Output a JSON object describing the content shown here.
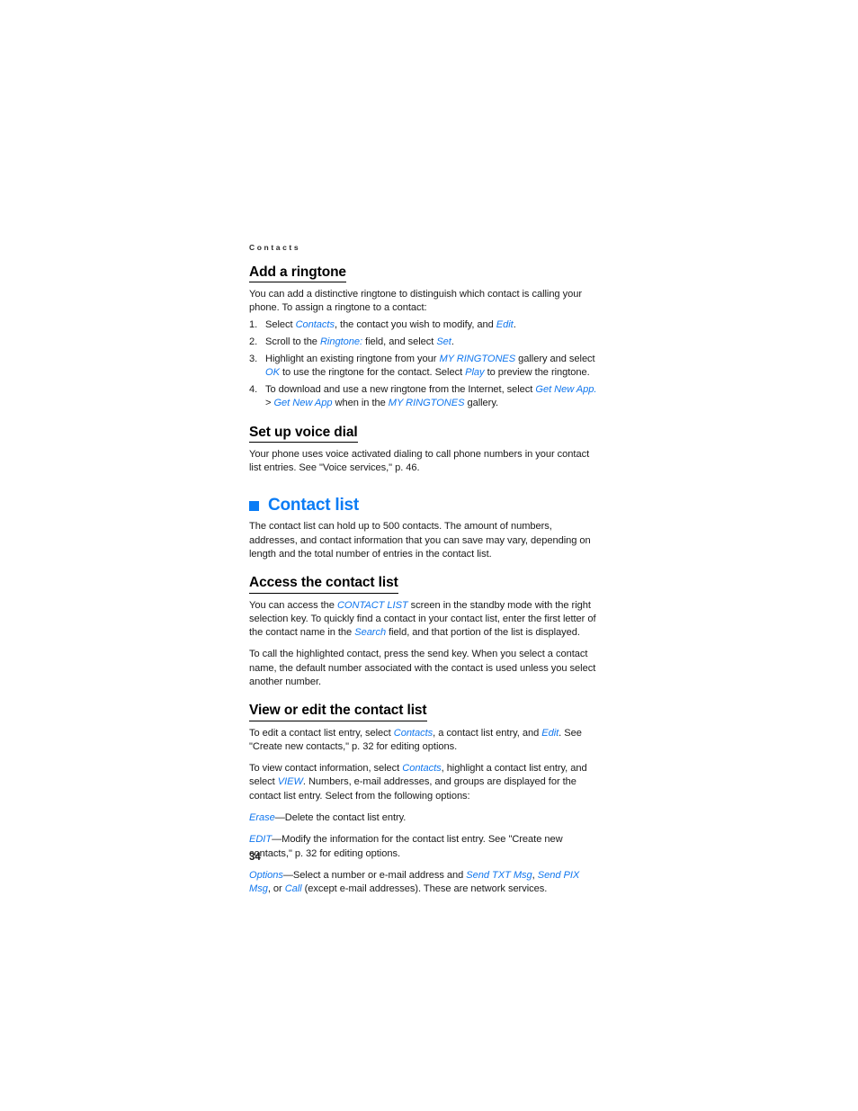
{
  "document": {
    "running_head": "Contacts",
    "page_number": "34"
  },
  "sections": {
    "add_ringtone": {
      "heading": "Add a ringtone",
      "intro": "You can add a distinctive ringtone to distinguish which contact is calling your phone. To assign a ringtone to a contact:",
      "steps": [
        {
          "number": "1.",
          "parts": [
            {
              "text": "Select ",
              "style": "plain"
            },
            {
              "text": "Contacts",
              "style": "ui"
            },
            {
              "text": ", the contact you wish to modify, and ",
              "style": "plain"
            },
            {
              "text": "Edit",
              "style": "ui"
            },
            {
              "text": ".",
              "style": "plain"
            }
          ]
        },
        {
          "number": "2.",
          "parts": [
            {
              "text": "Scroll to the ",
              "style": "plain"
            },
            {
              "text": "Ringtone:",
              "style": "ui"
            },
            {
              "text": " field, and select ",
              "style": "plain"
            },
            {
              "text": "Set",
              "style": "ui"
            },
            {
              "text": ".",
              "style": "plain"
            }
          ]
        },
        {
          "number": "3.",
          "parts": [
            {
              "text": "Highlight an existing ringtone from your ",
              "style": "plain"
            },
            {
              "text": "MY RINGTONES",
              "style": "ui"
            },
            {
              "text": " gallery and select ",
              "style": "plain"
            },
            {
              "text": "OK",
              "style": "ui"
            },
            {
              "text": " to use the ringtone for the contact. Select ",
              "style": "plain"
            },
            {
              "text": "Play",
              "style": "ui"
            },
            {
              "text": " to preview the ringtone.",
              "style": "plain"
            }
          ]
        },
        {
          "number": "4.",
          "parts": [
            {
              "text": "To download and use a new ringtone from the Internet, select ",
              "style": "plain"
            },
            {
              "text": "Get New App.",
              "style": "ui"
            },
            {
              "text": " > ",
              "style": "plain"
            },
            {
              "text": "Get New App",
              "style": "ui"
            },
            {
              "text": " when in the ",
              "style": "plain"
            },
            {
              "text": "MY RINGTONES",
              "style": "ui"
            },
            {
              "text": " gallery.",
              "style": "plain"
            }
          ]
        }
      ]
    },
    "voice_dial": {
      "heading": "Set up voice dial",
      "body": "Your phone uses voice activated dialing to call phone numbers in your contact list entries. See \"Voice services,\" p. 46."
    },
    "contact_list": {
      "heading": "Contact list",
      "bullet_color": "#0a7cf5",
      "body": "The contact list can hold up to 500 contacts. The amount of numbers, addresses, and contact information that you can save may vary, depending on length and the total number of entries in the contact list."
    },
    "access_contact_list": {
      "heading": "Access the contact list",
      "paragraph_1": [
        {
          "text": "You can access the ",
          "style": "plain"
        },
        {
          "text": "CONTACT LIST",
          "style": "ui"
        },
        {
          "text": " screen in the standby mode with the right selection key. To quickly find a contact in your contact list, enter the first letter of the contact name in the ",
          "style": "plain"
        },
        {
          "text": "Search",
          "style": "ui"
        },
        {
          "text": " field, and that portion of the list is displayed.",
          "style": "plain"
        }
      ],
      "paragraph_2": "To call the highlighted contact, press the send key. When you select a contact name, the default number associated with the contact is used unless you select another number."
    },
    "view_edit_contact_list": {
      "heading": "View or edit the contact list",
      "paragraph_1": [
        {
          "text": "To edit a contact list entry, select ",
          "style": "plain"
        },
        {
          "text": "Contacts",
          "style": "ui"
        },
        {
          "text": ", a contact list entry, and ",
          "style": "plain"
        },
        {
          "text": "Edit",
          "style": "ui"
        },
        {
          "text": ". See \"Create new contacts,\" p. 32 for editing options.",
          "style": "plain"
        }
      ],
      "paragraph_2": [
        {
          "text": "To view contact information, select ",
          "style": "plain"
        },
        {
          "text": "Contacts",
          "style": "ui"
        },
        {
          "text": ", highlight a contact list entry, and select ",
          "style": "plain"
        },
        {
          "text": "VIEW",
          "style": "ui"
        },
        {
          "text": ". Numbers, e-mail addresses, and groups are displayed for the contact list entry. Select from the following options:",
          "style": "plain"
        }
      ],
      "options": [
        [
          {
            "text": "Erase",
            "style": "ui"
          },
          {
            "text": "—Delete the contact list entry.",
            "style": "plain"
          }
        ],
        [
          {
            "text": "EDIT",
            "style": "ui"
          },
          {
            "text": "—Modify the information for the contact list entry. See \"Create new contacts,\" p. 32 for editing options.",
            "style": "plain"
          }
        ],
        [
          {
            "text": "Options",
            "style": "ui"
          },
          {
            "text": "—Select a number or e-mail address and ",
            "style": "plain"
          },
          {
            "text": "Send TXT Msg",
            "style": "ui"
          },
          {
            "text": ", ",
            "style": "plain"
          },
          {
            "text": "Send PIX Msg",
            "style": "ui"
          },
          {
            "text": ", or ",
            "style": "plain"
          },
          {
            "text": "Call",
            "style": "ui"
          },
          {
            "text": " (except e-mail addresses). These are network services.",
            "style": "plain"
          }
        ]
      ]
    }
  }
}
